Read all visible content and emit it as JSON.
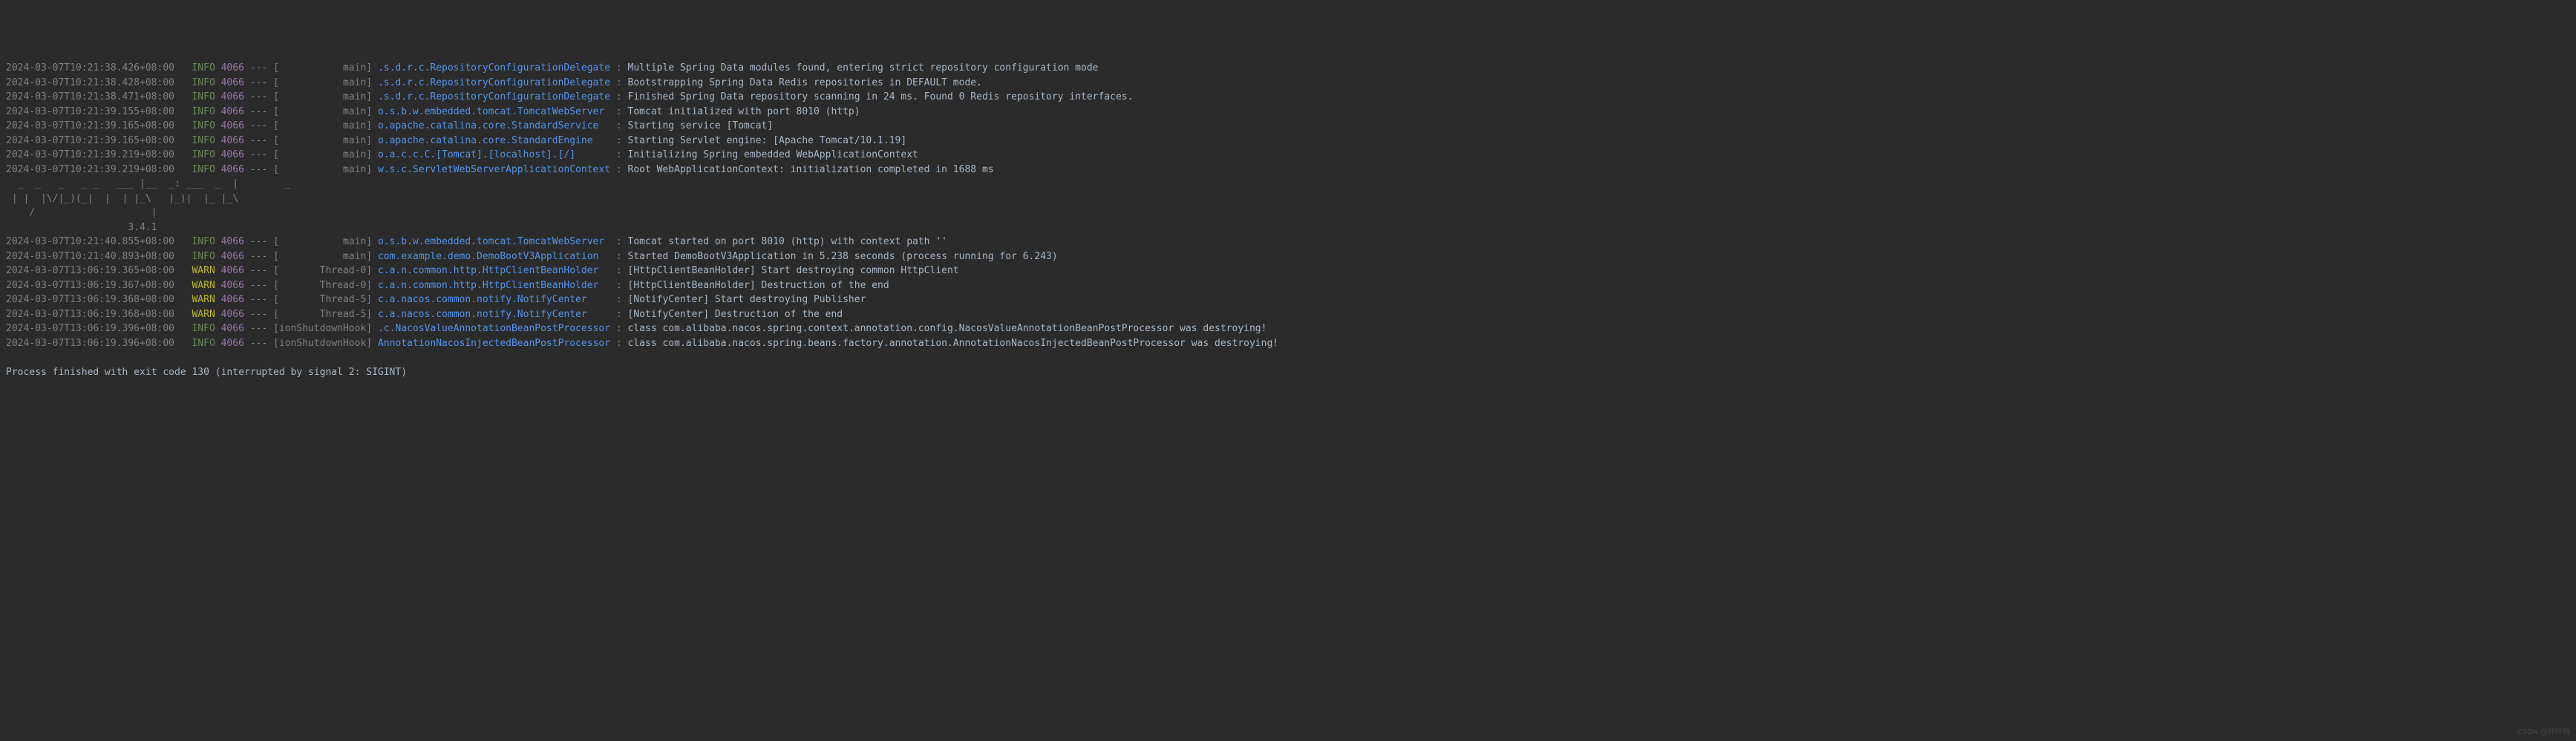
{
  "logs": [
    {
      "ts": "2024-03-07T10:21:38.426+08:00",
      "level": "INFO",
      "pid": "4066",
      "thread": "main",
      "logger": ".s.d.r.c.RepositoryConfigurationDelegate",
      "msg": "Multiple Spring Data modules found, entering strict repository configuration mode"
    },
    {
      "ts": "2024-03-07T10:21:38.428+08:00",
      "level": "INFO",
      "pid": "4066",
      "thread": "main",
      "logger": ".s.d.r.c.RepositoryConfigurationDelegate",
      "msg": "Bootstrapping Spring Data Redis repositories in DEFAULT mode."
    },
    {
      "ts": "2024-03-07T10:21:38.471+08:00",
      "level": "INFO",
      "pid": "4066",
      "thread": "main",
      "logger": ".s.d.r.c.RepositoryConfigurationDelegate",
      "msg": "Finished Spring Data repository scanning in 24 ms. Found 0 Redis repository interfaces."
    },
    {
      "ts": "2024-03-07T10:21:39.155+08:00",
      "level": "INFO",
      "pid": "4066",
      "thread": "main",
      "logger": "o.s.b.w.embedded.tomcat.TomcatWebServer",
      "msg": "Tomcat initialized with port 8010 (http)"
    },
    {
      "ts": "2024-03-07T10:21:39.165+08:00",
      "level": "INFO",
      "pid": "4066",
      "thread": "main",
      "logger": "o.apache.catalina.core.StandardService",
      "msg": "Starting service [Tomcat]"
    },
    {
      "ts": "2024-03-07T10:21:39.165+08:00",
      "level": "INFO",
      "pid": "4066",
      "thread": "main",
      "logger": "o.apache.catalina.core.StandardEngine",
      "msg": "Starting Servlet engine: [Apache Tomcat/10.1.19]"
    },
    {
      "ts": "2024-03-07T10:21:39.219+08:00",
      "level": "INFO",
      "pid": "4066",
      "thread": "main",
      "logger": "o.a.c.c.C.[Tomcat].[localhost].[/]",
      "msg": "Initializing Spring embedded WebApplicationContext"
    },
    {
      "ts": "2024-03-07T10:21:39.219+08:00",
      "level": "INFO",
      "pid": "4066",
      "thread": "main",
      "logger": "w.s.c.ServletWebServerApplicationContext",
      "msg": "Root WebApplicationContext: initialization completed in 1688 ms"
    }
  ],
  "ascii": {
    "line1": "  _  _   _   _ _   ___ |__  _: ___  _  |        _",
    "line2": " | |  |\\/|_)(_|  |  | |_\\   |_)|  |_ |_\\",
    "line3": "    /                    |",
    "line4": "                     3.4.1"
  },
  "logs2": [
    {
      "ts": "2024-03-07T10:21:40.855+08:00",
      "level": "INFO",
      "pid": "4066",
      "thread": "main",
      "logger": "o.s.b.w.embedded.tomcat.TomcatWebServer",
      "msg": "Tomcat started on port 8010 (http) with context path ''"
    },
    {
      "ts": "2024-03-07T10:21:40.893+08:00",
      "level": "INFO",
      "pid": "4066",
      "thread": "main",
      "logger": "com.example.demo.DemoBootV3Application",
      "msg": "Started DemoBootV3Application in 5.238 seconds (process running for 6.243)"
    },
    {
      "ts": "2024-03-07T13:06:19.365+08:00",
      "level": "WARN",
      "pid": "4066",
      "thread": "Thread-0",
      "logger": "c.a.n.common.http.HttpClientBeanHolder",
      "msg": "[HttpClientBeanHolder] Start destroying common HttpClient"
    },
    {
      "ts": "2024-03-07T13:06:19.367+08:00",
      "level": "WARN",
      "pid": "4066",
      "thread": "Thread-0",
      "logger": "c.a.n.common.http.HttpClientBeanHolder",
      "msg": "[HttpClientBeanHolder] Destruction of the end"
    },
    {
      "ts": "2024-03-07T13:06:19.368+08:00",
      "level": "WARN",
      "pid": "4066",
      "thread": "Thread-5",
      "logger": "c.a.nacos.common.notify.NotifyCenter",
      "msg": "[NotifyCenter] Start destroying Publisher"
    },
    {
      "ts": "2024-03-07T13:06:19.368+08:00",
      "level": "WARN",
      "pid": "4066",
      "thread": "Thread-5",
      "logger": "c.a.nacos.common.notify.NotifyCenter",
      "msg": "[NotifyCenter] Destruction of the end"
    },
    {
      "ts": "2024-03-07T13:06:19.396+08:00",
      "level": "INFO",
      "pid": "4066",
      "thread": "ionShutdownHook",
      "logger": ".c.NacosValueAnnotationBeanPostProcessor",
      "msg": "class com.alibaba.nacos.spring.context.annotation.config.NacosValueAnnotationBeanPostProcessor was destroying!"
    },
    {
      "ts": "2024-03-07T13:06:19.396+08:00",
      "level": "INFO",
      "pid": "4066",
      "thread": "ionShutdownHook",
      "logger": "AnnotationNacosInjectedBeanPostProcessor",
      "msg": "class com.alibaba.nacos.spring.beans.factory.annotation.AnnotationNacosInjectedBeanPostProcessor was destroying!"
    }
  ],
  "exit": "Process finished with exit code 130 (interrupted by signal 2: SIGINT)",
  "watermark": "CSDN @咔咔狗"
}
